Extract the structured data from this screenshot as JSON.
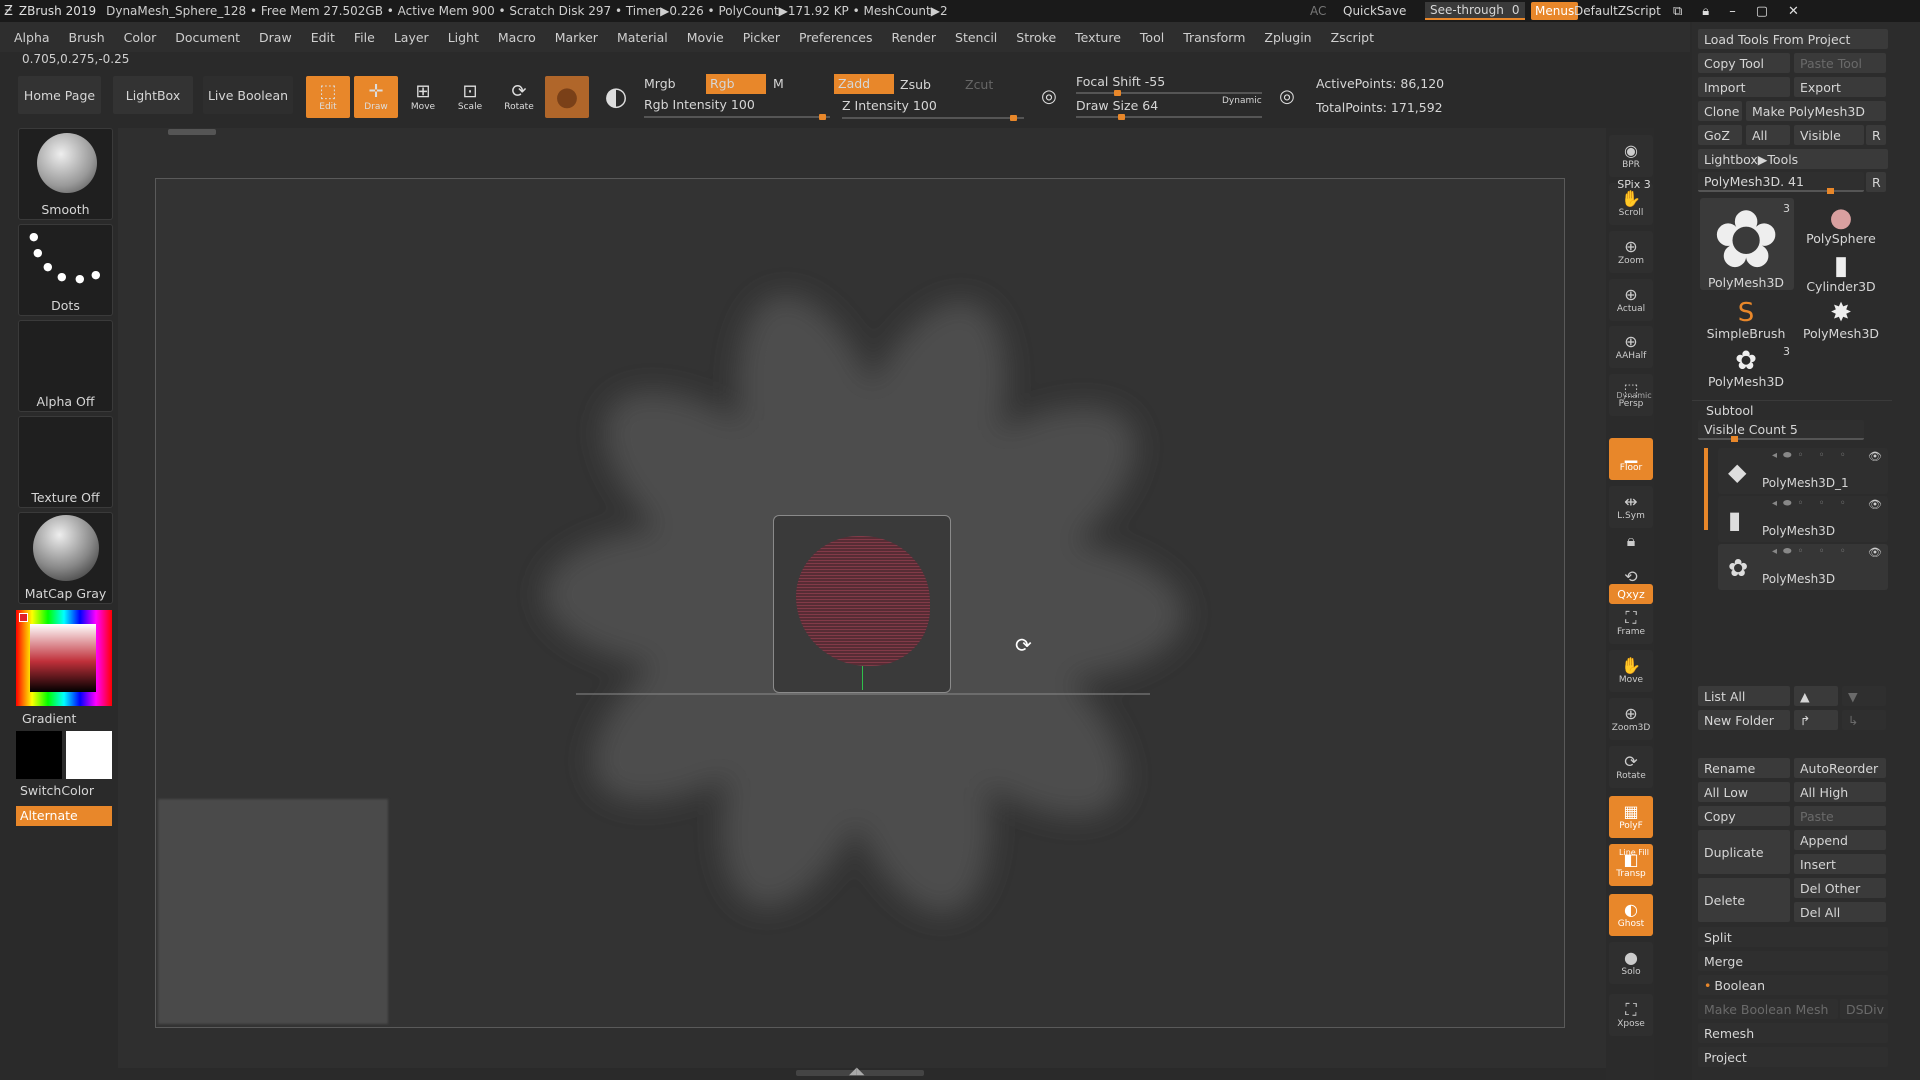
{
  "titlebar": {
    "app": "ZBrush 2019",
    "info": "DynaMesh_Sphere_128   • Free Mem 27.502GB • Active Mem 900 • Scratch Disk 297 • Timer▶0.226 • PolyCount▶171.92 KP • MeshCount▶2",
    "ac": "AC",
    "quicksave": "QuickSave",
    "seethrough": "See-through",
    "seethrough_value": "0",
    "menus": "Menus",
    "script": "DefaultZScript"
  },
  "menubar": [
    "Alpha",
    "Brush",
    "Color",
    "Document",
    "Draw",
    "Edit",
    "File",
    "Layer",
    "Light",
    "Macro",
    "Marker",
    "Material",
    "Movie",
    "Picker",
    "Preferences",
    "Render",
    "Stencil",
    "Stroke",
    "Texture",
    "Tool",
    "Transform",
    "Zplugin",
    "Zscript"
  ],
  "coords": "0.705,0.275,-0.25",
  "toolbar": {
    "home": "Home Page",
    "lightbox": "LightBox",
    "liveboolean": "Live Boolean",
    "edit": "Edit",
    "draw": "Draw",
    "move": "Move",
    "scale": "Scale",
    "rotate": "Rotate",
    "mrgb": "Mrgb",
    "rgb": "Rgb",
    "m": "M",
    "rgb_intensity": "Rgb Intensity 100",
    "zadd": "Zadd",
    "zsub": "Zsub",
    "zcut": "Zcut",
    "z_intensity": "Z Intensity 100",
    "focal_shift": "Focal Shift -55",
    "draw_size": "Draw Size 64",
    "dynamic": "Dynamic",
    "active_points": "ActivePoints: 86,120",
    "total_points": "TotalPoints: 171,592"
  },
  "leftpanel": {
    "smooth": "Smooth",
    "dots": "Dots",
    "alpha": "Alpha Off",
    "texture": "Texture Off",
    "matcap": "MatCap Gray",
    "gradient": "Gradient",
    "switchcolor": "SwitchColor",
    "alternate": "Alternate"
  },
  "rightstrip": [
    "BPR",
    "Scroll",
    "Zoom",
    "Actual",
    "AAHalf",
    "Persp",
    "Floor",
    "L.Sym",
    "",
    "",
    "Frame",
    "Move",
    "Zoom3D",
    "Rotate",
    "PolyF",
    "Transp",
    "Ghost",
    "Solo",
    "Xpose"
  ],
  "rightstrip_extra": {
    "spix": "SPix 3",
    "dynamic": "Dynamic",
    "xyz": "Qxyz",
    "linefill": "Line Fill"
  },
  "panel": {
    "load_tools": "Load Tools From Project",
    "copy_tool": "Copy Tool",
    "paste_tool": "Paste Tool",
    "import": "Import",
    "export": "Export",
    "clone": "Clone",
    "make_polymesh": "Make PolyMesh3D",
    "goz": "GoZ",
    "all": "All",
    "visible": "Visible",
    "r": "R",
    "lightbox_tools": "Lightbox▶Tools",
    "polymesh_slider": "PolyMesh3D. 41",
    "tools": [
      {
        "name": "PolyMesh3D",
        "badge": "3"
      },
      {
        "name": "PolySphere",
        "badge": ""
      },
      {
        "name": "Cylinder3D",
        "badge": ""
      },
      {
        "name": "SimpleBrush",
        "badge": ""
      },
      {
        "name": "PolyMesh3D",
        "badge": ""
      },
      {
        "name": "PolyMesh3D",
        "badge": "3"
      }
    ],
    "subtool": "Subtool",
    "visible_count": "Visible Count 5",
    "subtools": [
      "PolyMesh3D_1",
      "PolyMesh3D",
      "PolyMesh3D"
    ],
    "list_all": "List All",
    "new_folder": "New Folder",
    "rename": "Rename",
    "autoreorder": "AutoReorder",
    "all_low": "All Low",
    "all_high": "All High",
    "copy": "Copy",
    "paste": "Paste",
    "duplicate": "Duplicate",
    "append": "Append",
    "insert": "Insert",
    "delete": "Delete",
    "del_other": "Del Other",
    "del_all": "Del All",
    "split": "Split",
    "merge": "Merge",
    "boolean": "Boolean",
    "make_boolean": "Make Boolean Mesh",
    "dsdiv": "DSDiv",
    "remesh": "Remesh",
    "project": "Project"
  },
  "colors": {
    "accent": "#e8872a",
    "bg": "#2a2a2a",
    "panel": "#2c2c2c"
  }
}
